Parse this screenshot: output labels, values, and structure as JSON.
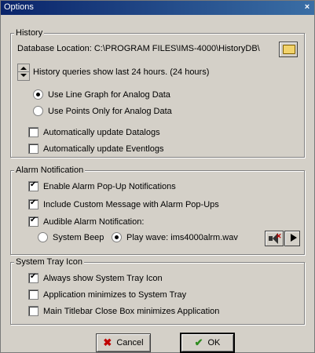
{
  "window": {
    "title": "Options",
    "close_glyph": "×"
  },
  "history": {
    "legend": "History",
    "db_location": "Database Location: C:\\PROGRAM FILES\\IMS-4000\\HistoryDB\\",
    "browse_icon": "folder-open-icon",
    "query_text": "History queries show last 24 hours. (24 hours)",
    "radio_line_graph": "Use Line Graph for Analog Data",
    "radio_points_only": "Use Points Only for Analog Data",
    "auto_datalogs": "Automatically update Datalogs",
    "auto_eventlogs": "Automatically update Eventlogs"
  },
  "alarm": {
    "legend": "Alarm Notification",
    "enable_popups": "Enable Alarm Pop-Up Notifications",
    "include_custom": "Include Custom Message with Alarm Pop-Ups",
    "audible": "Audible Alarm Notification:",
    "system_beep": "System Beep",
    "play_wave": "Play wave: ims4000alrm.wav",
    "speaker_icon": "speaker-mute-icon",
    "play_icon": "play-icon"
  },
  "tray": {
    "legend": "System Tray Icon",
    "always_show": "Always show System Tray Icon",
    "minimize_to_tray": "Application minimizes to System Tray",
    "close_box_minimizes": "Main Titlebar Close Box minimizes Application"
  },
  "buttons": {
    "cancel": "Cancel",
    "ok": "OK",
    "cancel_icon": "x-icon",
    "ok_icon": "check-icon",
    "cancel_icon_color": "#c00000",
    "ok_icon_color": "#2e8b1e"
  }
}
